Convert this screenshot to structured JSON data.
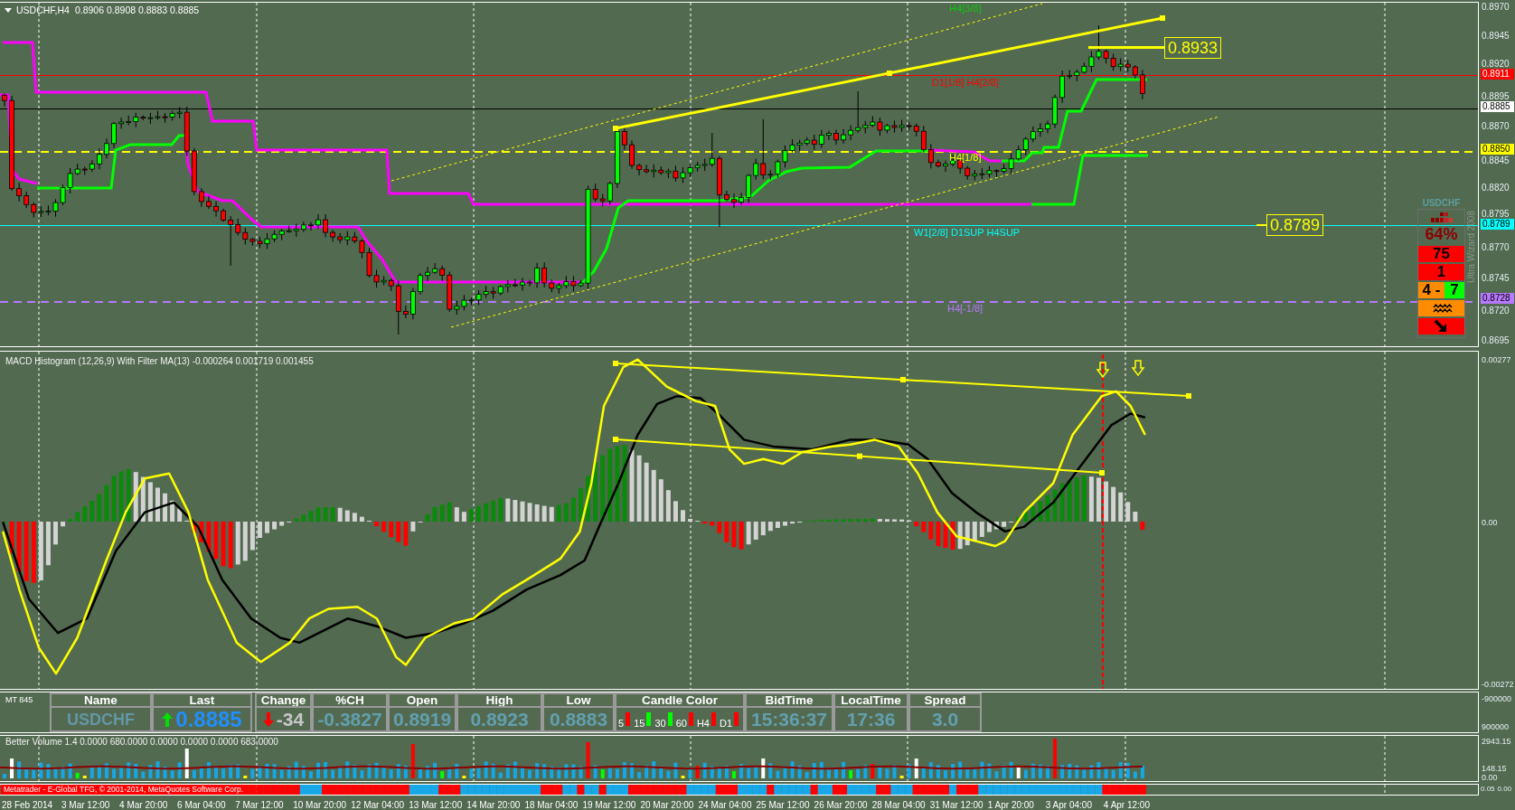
{
  "main_chart": {
    "title": "USDCHF,H4",
    "ohlc": "0.8906 0.8908 0.8883 0.8885",
    "price_axis": [
      "0.8970",
      "0.8945",
      "0.8920",
      "0.8895",
      "0.8870",
      "0.8845",
      "0.8820",
      "0.8795",
      "0.8770",
      "0.8745",
      "0.8720",
      "0.8695"
    ],
    "levels": [
      {
        "kind": "label_only",
        "label": "H4[3/8]",
        "color": "#10c810"
      },
      {
        "kind": "solid",
        "label": "D1[1/8] H4[2/8]",
        "price_tag": "0.8911",
        "color": "#ff0000"
      },
      {
        "kind": "dashed",
        "label": "H4[1/8]",
        "price_tag": "0.8850",
        "color": "#ffff00"
      },
      {
        "kind": "solid",
        "label": "W1[2/8] D1SUP H4SUP",
        "price_tag": "0.8789",
        "color": "#00ffff"
      },
      {
        "kind": "dashed",
        "label": "H4[-1/8]",
        "price_tag": "0.8728",
        "color": "#b878ff"
      }
    ],
    "bid_tag": "0.8885",
    "price_labels": [
      "0.8933",
      "0.8789"
    ],
    "wizard": {
      "symbol": "USDCHF",
      "percent": "64%",
      "rows": [
        {
          "kind": "text",
          "text": "75",
          "color": "#ff0000"
        },
        {
          "kind": "text",
          "text": "1",
          "color": "#ff0000"
        },
        {
          "kind": "split",
          "cells": [
            {
              "text": "4 -",
              "color": "#ff8c00"
            },
            {
              "text": "7",
              "color": "#00ff00"
            }
          ]
        },
        {
          "kind": "waves",
          "color": "#ff8c00"
        },
        {
          "kind": "arrow",
          "color": "#ff0000"
        }
      ],
      "vertical_caption": "Ultra Wizard 2008"
    }
  },
  "macd": {
    "title": "MACD Histogram (12,26,9) With Filter MA(13) -0.000264 0.001719 0.001455",
    "axis": [
      "0.00277",
      "0.00",
      "-0.00272"
    ]
  },
  "quote_table": {
    "label": "MT 845",
    "columns": [
      {
        "header": "Name",
        "kind": "name",
        "value": "USDCHF"
      },
      {
        "header": "Last",
        "kind": "last",
        "value": "0.8885",
        "up": true
      },
      {
        "header": "Change",
        "kind": "change",
        "value": "-34",
        "up": false
      },
      {
        "header": "%CH",
        "kind": "plain",
        "value": "-0.3827"
      },
      {
        "header": "Open",
        "kind": "plain",
        "value": "0.8919"
      },
      {
        "header": "High",
        "kind": "plain",
        "value": "0.8923"
      },
      {
        "header": "Low",
        "kind": "plain",
        "value": "0.8883"
      },
      {
        "header": "Candle Color",
        "kind": "timeframes",
        "timeframes": [
          {
            "label": "5",
            "color": "#ff0000"
          },
          {
            "label": "15",
            "color": "#00ff00"
          },
          {
            "label": "30",
            "color": "#00ff00"
          },
          {
            "label": "60",
            "color": "#ff0000"
          },
          {
            "label": "H4",
            "color": "#ff0000"
          },
          {
            "label": "D1",
            "color": "#ff0000"
          }
        ]
      },
      {
        "header": "BidTime",
        "kind": "plain",
        "value": "15:36:37"
      },
      {
        "header": "LocalTime",
        "kind": "plain",
        "value": "17:36"
      },
      {
        "header": "Spread",
        "kind": "plain",
        "value": "3.0"
      }
    ],
    "axis": [
      "-900000",
      "900000"
    ]
  },
  "volume": {
    "title": "Better Volume 1.4 0.0000 680.0000 0.0000 0.0000 0.0000 683.0000",
    "axis": [
      "2943.15",
      "148.15",
      "0.00"
    ]
  },
  "bottom_strip": {
    "caption": "Metatrader - E-Global TFG, © 2001-2014, MetaQuotes Software Corp.",
    "axis": [
      "0.05",
      "0.00"
    ]
  },
  "time_axis": [
    "28 Feb 2014",
    "3 Mar 12:00",
    "4 Mar 20:00",
    "6 Mar 04:00",
    "7 Mar 12:00",
    "10 Mar 20:00",
    "12 Mar 04:00",
    "13 Mar 12:00",
    "14 Mar 20:00",
    "18 Mar 04:00",
    "19 Mar 12:00",
    "20 Mar 20:00",
    "24 Mar 04:00",
    "25 Mar 12:00",
    "26 Mar 20:00",
    "28 Mar 04:00",
    "31 Mar 12:00",
    "1 Apr 20:00",
    "3 Apr 04:00",
    "4 Apr 12:00"
  ]
}
